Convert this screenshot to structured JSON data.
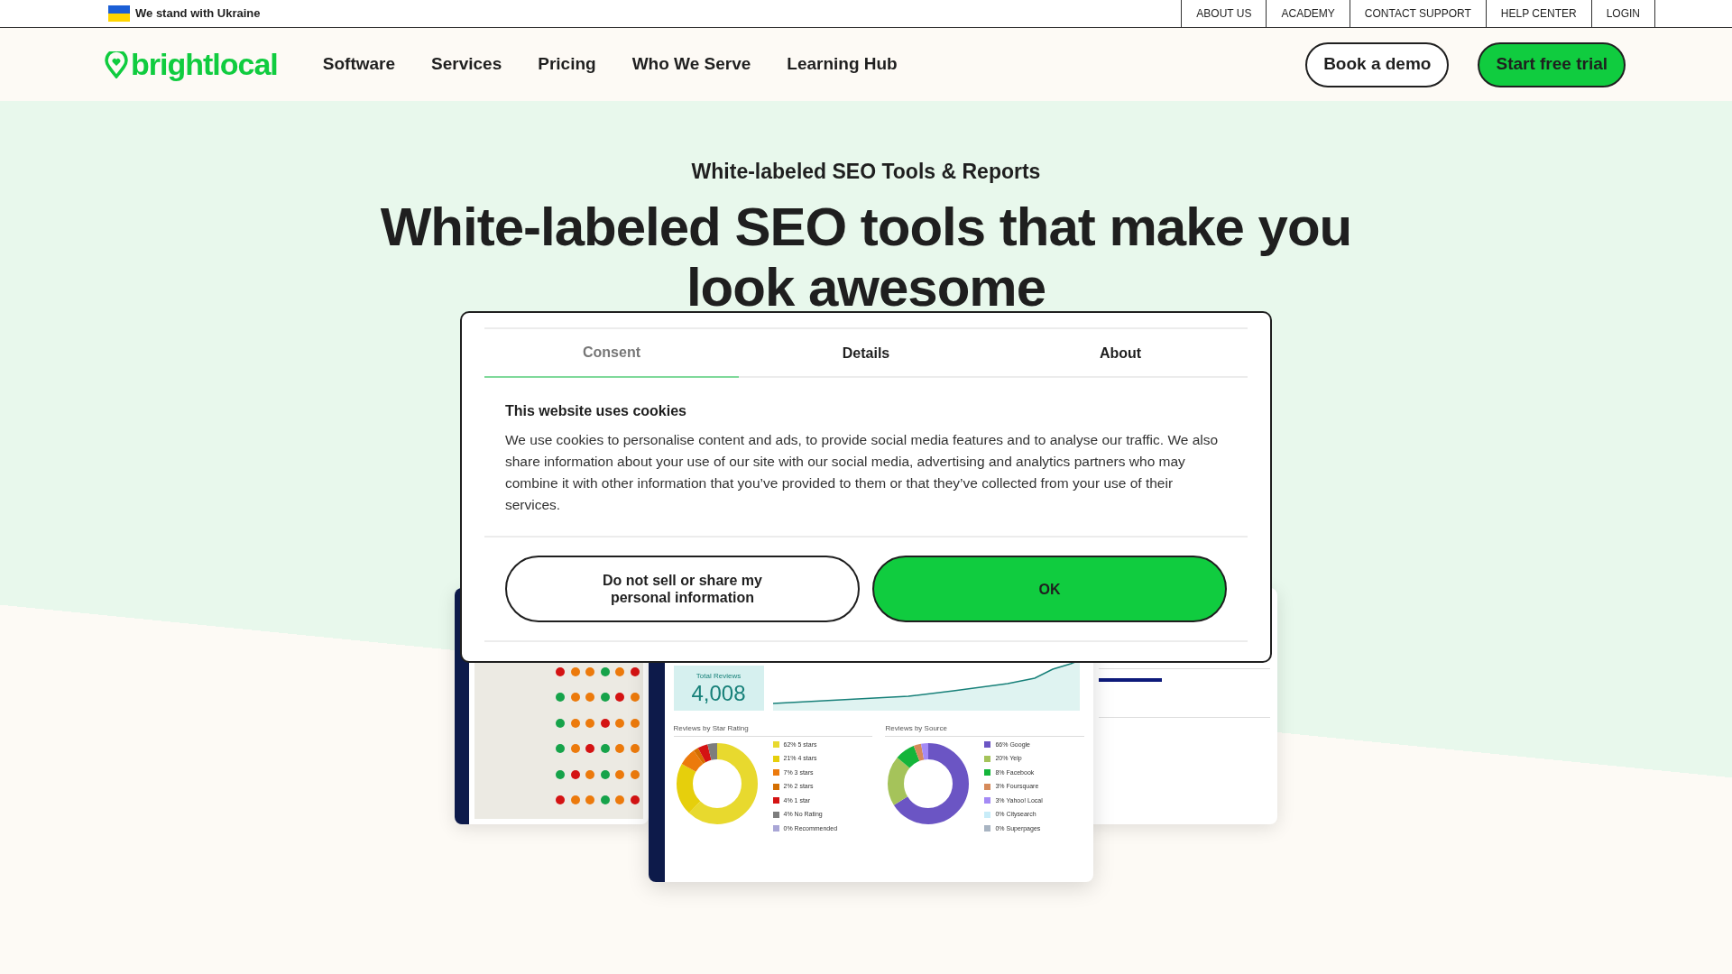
{
  "top_bar": {
    "notice": "We stand with Ukraine",
    "links": [
      "ABOUT US",
      "ACADEMY",
      "CONTACT SUPPORT",
      "HELP CENTER",
      "LOGIN"
    ]
  },
  "nav": {
    "logo": "brightlocal",
    "items": [
      "Software",
      "Services",
      "Pricing",
      "Who We Serve",
      "Learning Hub"
    ],
    "buttons": [
      {
        "label": "Book a demo",
        "kind": "outline"
      },
      {
        "label": "Start free trial",
        "kind": "primary"
      }
    ]
  },
  "hero": {
    "eyebrow": "White-labeled SEO Tools & Reports",
    "title": "White-labeled SEO tools that make you look awesome"
  },
  "product_screens": {
    "total_reviews_label": "Total Reviews",
    "total_reviews": "4,008",
    "star_chart_title": "Reviews by Star Rating",
    "star_legend": [
      {
        "label": "62% 5 stars",
        "color": "#e8d92e"
      },
      {
        "label": "21% 4 stars",
        "color": "#e6cf0c"
      },
      {
        "label": "7% 3 stars",
        "color": "#ec7a0c"
      },
      {
        "label": "2% 2 stars",
        "color": "#d46e00"
      },
      {
        "label": "4% 1 star",
        "color": "#d41313"
      },
      {
        "label": "4% No Rating",
        "color": "#7d7d7d"
      },
      {
        "label": "0% Recommended",
        "color": "#a9a6d6"
      }
    ],
    "source_chart_title": "Reviews by Source",
    "source_legend": [
      {
        "label": "66% Google",
        "color": "#6b55c4"
      },
      {
        "label": "20% Yelp",
        "color": "#a5c35a"
      },
      {
        "label": "8% Facebook",
        "color": "#14b53a"
      },
      {
        "label": "3% Foursquare",
        "color": "#d68a5a"
      },
      {
        "label": "3% Yahoo! Local",
        "color": "#a48af5"
      },
      {
        "label": "0% Citysearch",
        "color": "#c8ecf8"
      },
      {
        "label": "0% Superpages",
        "color": "#a8b4c2"
      }
    ]
  },
  "cookie_dialog": {
    "tabs": [
      {
        "label": "Consent",
        "selected": true
      },
      {
        "label": "Details",
        "selected": false
      },
      {
        "label": "About",
        "selected": false
      }
    ],
    "title": "This website uses cookies",
    "body": "We use cookies to personalise content and ads, to provide social media features and to analyse our traffic. We also share information about your use of our site with our social media, advertising and analytics partners who may combine it with other information that you’ve provided to them or that they’ve collected from your use of their services.",
    "buttons": [
      {
        "label": "Do not sell or share my personal information",
        "kind": "outline"
      },
      {
        "label": "OK",
        "kind": "primary"
      }
    ]
  }
}
